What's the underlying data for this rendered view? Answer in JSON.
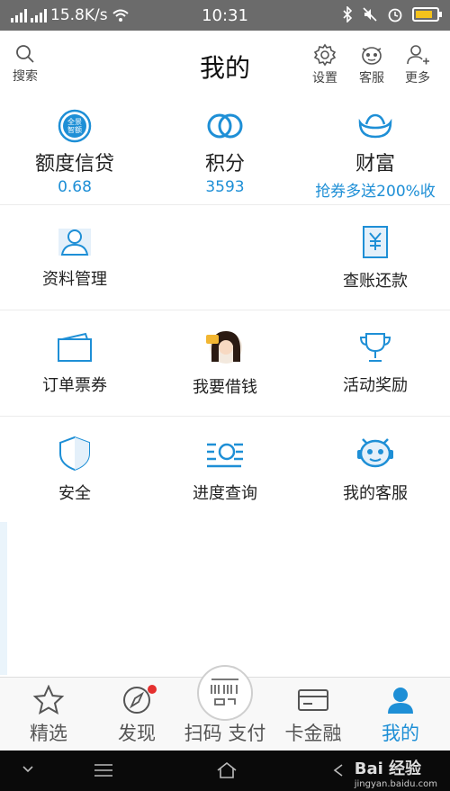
{
  "status_bar": {
    "network_speed": "15.8K/s",
    "time": "10:31"
  },
  "header": {
    "title": "我的",
    "search_label": "搜索",
    "settings_label": "设置",
    "service_label": "客服",
    "more_label": "更多"
  },
  "summary": [
    {
      "title": "额度信贷",
      "value": "0.68",
      "badge": "全景智额"
    },
    {
      "title": "积分",
      "value": "3593"
    },
    {
      "title": "财富",
      "value": "抢券多送200%收"
    }
  ],
  "grid": {
    "profile": "资料管理",
    "bills": "查账还款",
    "orders": "订单票券",
    "borrow": "我要借钱",
    "rewards": "活动奖励",
    "security": "安全",
    "progress": "进度查询",
    "my_service": "我的客服"
  },
  "tabbar": {
    "featured": "精选",
    "discover": "发现",
    "scan_pay": "扫码 支付",
    "card_finance": "卡金融",
    "mine": "我的"
  },
  "watermark": {
    "brand": "Bai 经验",
    "url": "jingyan.baidu.com"
  },
  "colors": {
    "accent": "#1e8fd6",
    "status_bar": "#6b6b6b",
    "badge_dot": "#e5302f"
  }
}
